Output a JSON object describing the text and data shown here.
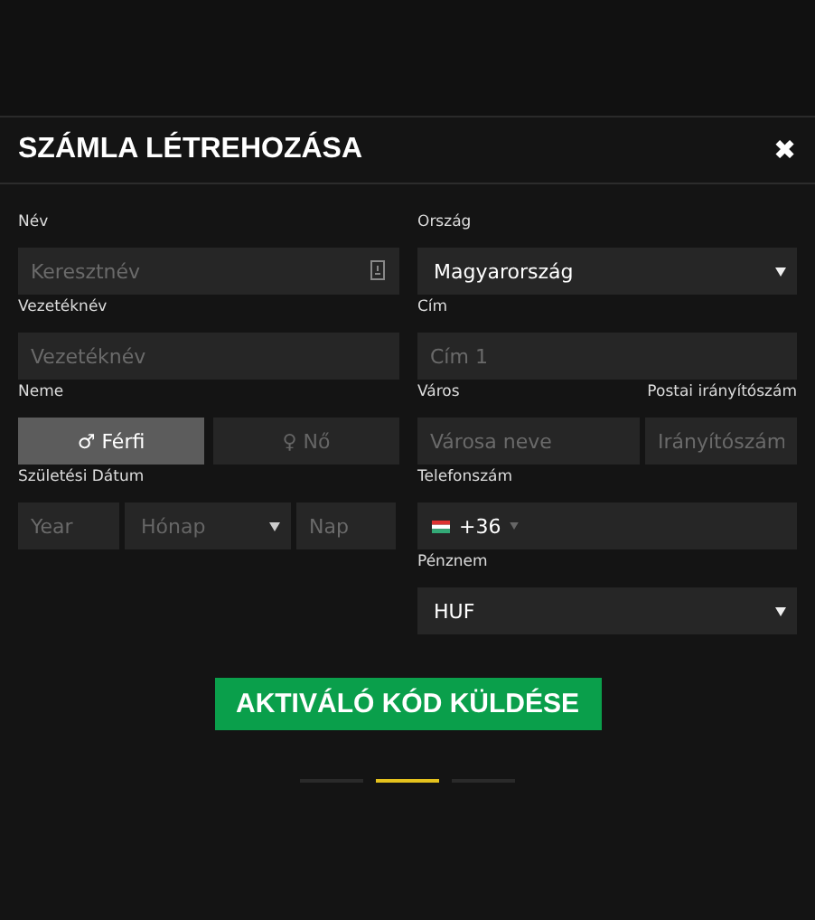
{
  "dialog": {
    "title": "SZÁMLA LÉTREHOZÁSA",
    "close": "✖"
  },
  "left": {
    "name_label": "Név",
    "first_name": {
      "placeholder": "Keresztnév"
    },
    "last_name_label": "Vezetéknév",
    "last_name": {
      "placeholder": "Vezetéknév"
    },
    "gender_label": "Neme",
    "genders": [
      {
        "symbol": "♂",
        "label": "Férfi",
        "selected": true
      },
      {
        "symbol": "♀",
        "label": "Nő",
        "selected": false
      }
    ],
    "birth_label": "Születési Dátum",
    "year": {
      "placeholder": "Year"
    },
    "month": {
      "placeholder": "Hónap"
    },
    "day": {
      "placeholder": "Nap"
    }
  },
  "right": {
    "country_label": "Ország",
    "country": "Magyarország",
    "address_label": "Cím",
    "address": {
      "placeholder": "Cím 1"
    },
    "city_label": "Város",
    "postal_label": "Postai irányítószám",
    "city": {
      "placeholder": "Városa neve"
    },
    "postal": {
      "placeholder": "Irányítószám"
    },
    "phone_label": "Telefonszám",
    "phone_code": "+36",
    "currency_label": "Pénznem",
    "currency": "HUF"
  },
  "submit": "AKTIVÁLÓ KÓD KÜLDÉSE",
  "steps": [
    {
      "selected": false
    },
    {
      "selected": true
    },
    {
      "selected": false
    }
  ]
}
